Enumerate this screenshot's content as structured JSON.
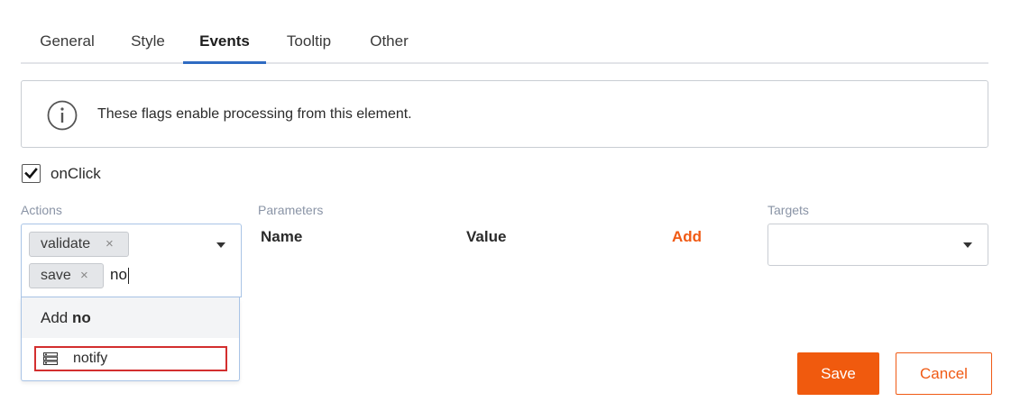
{
  "tabs": [
    {
      "label": "General",
      "active": false
    },
    {
      "label": "Style",
      "active": false
    },
    {
      "label": "Events",
      "active": true
    },
    {
      "label": "Tooltip",
      "active": false
    },
    {
      "label": "Other",
      "active": false
    }
  ],
  "info": {
    "icon": "info-circle-icon",
    "text": "These flags enable processing from this element."
  },
  "onclick": {
    "checked": true,
    "label": "onClick"
  },
  "actions": {
    "label": "Actions",
    "chips": [
      "validate",
      "save"
    ],
    "chip_remove_glyph": "×",
    "typed_value": "no",
    "dropdown": {
      "add_prefix": "Add",
      "add_term": "no",
      "options": [
        {
          "label": "notify",
          "icon": "list-icon"
        }
      ]
    }
  },
  "parameters": {
    "label": "Parameters",
    "name_header": "Name",
    "value_header": "Value",
    "add_label": "Add"
  },
  "targets": {
    "label": "Targets",
    "value": ""
  },
  "footer": {
    "save_label": "Save",
    "cancel_label": "Cancel"
  },
  "colors": {
    "accent": "#f05a0e",
    "tab_indicator": "#2f6bc2",
    "highlight_border": "#d32f2f"
  }
}
